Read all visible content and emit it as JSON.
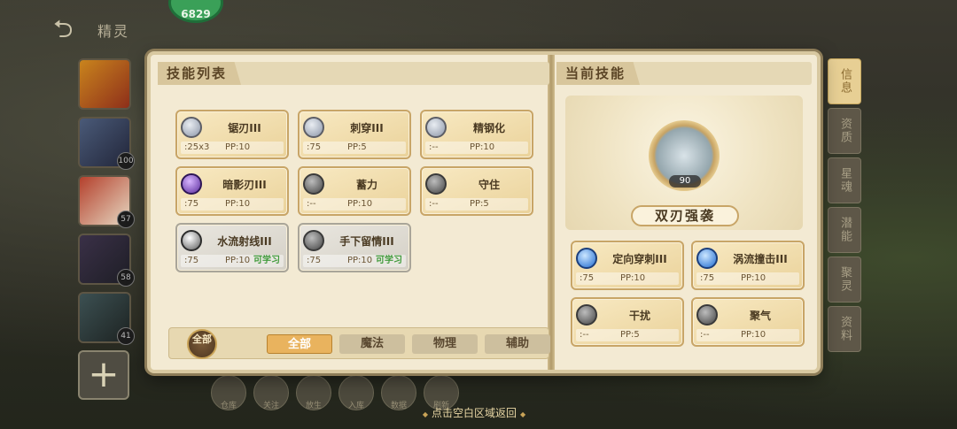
{
  "header": {
    "back_icon": "back-arrow-icon",
    "title": "精灵",
    "badge": "6829"
  },
  "pets": [
    {
      "level": ""
    },
    {
      "level": "100"
    },
    {
      "level": "57"
    },
    {
      "level": "58"
    },
    {
      "level": "41"
    }
  ],
  "add_pet": "+",
  "skill_list": {
    "title": "技能列表",
    "skills": [
      {
        "name": "锯刃III",
        "stat1": ":25x3",
        "pp": "PP:10",
        "learn": "",
        "icon": "blade-icon"
      },
      {
        "name": "刺穿III",
        "stat1": ":75",
        "pp": "PP:5",
        "learn": "",
        "icon": "pierce-icon"
      },
      {
        "name": "精钢化",
        "stat1": ":--",
        "pp": "PP:10",
        "learn": "",
        "icon": "steel-icon"
      },
      {
        "name": "暗影刃III",
        "stat1": ":75",
        "pp": "PP:10",
        "learn": "",
        "icon": "shadow-blade-icon"
      },
      {
        "name": "蓄力",
        "stat1": ":--",
        "pp": "PP:10",
        "learn": "",
        "icon": "charge-icon"
      },
      {
        "name": "守住",
        "stat1": ":--",
        "pp": "PP:5",
        "learn": "",
        "icon": "guard-icon"
      },
      {
        "name": "水流射线III",
        "stat1": ":75",
        "pp": "PP:10",
        "learn": "可学习",
        "icon": "water-beam-icon"
      },
      {
        "name": "手下留情III",
        "stat1": ":75",
        "pp": "PP:10",
        "learn": "可学习",
        "icon": "mercy-icon"
      }
    ]
  },
  "filter": {
    "badge": "全部",
    "tabs": [
      "全部",
      "魔法",
      "物理",
      "辅助"
    ],
    "active": "全部"
  },
  "current": {
    "title": "当前技能",
    "hero_name": "双刃强袭",
    "hero_power": "90",
    "skills": [
      {
        "name": "定向穿刺III",
        "stat1": ":75",
        "pp": "PP:10"
      },
      {
        "name": "涡流撞击III",
        "stat1": ":75",
        "pp": "PP:10"
      },
      {
        "name": "干扰",
        "stat1": ":--",
        "pp": "PP:5"
      },
      {
        "name": "聚气",
        "stat1": ":--",
        "pp": "PP:10"
      }
    ]
  },
  "side_tabs": [
    "信息",
    "资质",
    "星魂",
    "潜能",
    "聚灵",
    "资料"
  ],
  "dock": [
    "仓库",
    "关注",
    "放生",
    "入库",
    "数据",
    "刷新"
  ],
  "hint": "点击空白区域返回"
}
